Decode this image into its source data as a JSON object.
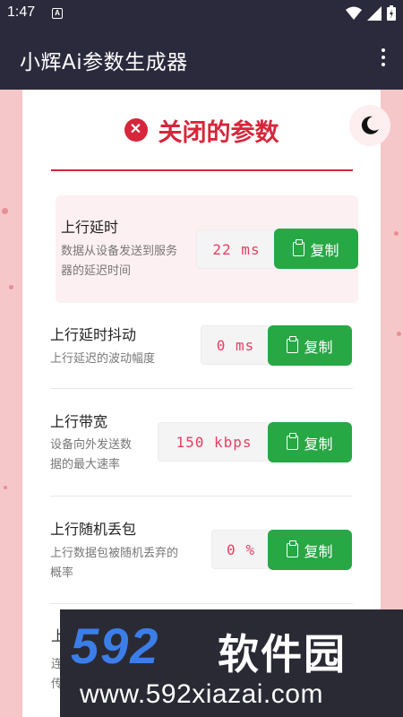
{
  "status_bar": {
    "time": "1:47",
    "notif_badge": "A"
  },
  "app_bar": {
    "title": "小辉Ai参数生成器"
  },
  "header": {
    "title": "关闭的参数"
  },
  "rows": [
    {
      "title": "上行延时",
      "desc_lines": [
        "数据从设备发送到服务",
        "器的延迟时间"
      ],
      "value": "22 ms",
      "copy_label": "复制"
    },
    {
      "title": "上行延时抖动",
      "desc_lines": [
        "上行延迟的波动幅度"
      ],
      "value": "0 ms",
      "copy_label": "复制"
    },
    {
      "title": "上行带宽",
      "desc_lines": [
        "设备向外发送数",
        "据的最大速率"
      ],
      "value": "150 kbps",
      "copy_label": "复制"
    },
    {
      "title": "上行随机丢包",
      "desc_lines": [
        "上行数据包被随机丢弃的",
        "概率"
      ],
      "value": "0 %",
      "copy_label": "复制"
    }
  ],
  "partial_row": {
    "title_peek": "上",
    "desc_peek_1": "连",
    "desc_peek_2": "传"
  },
  "watermark": {
    "brand_num": "592",
    "brand_cn": "软件园",
    "url": "www.592xiazai.com"
  },
  "colors": {
    "appbar": "#2b2a3d",
    "accent_red": "#d6263b",
    "copy_green": "#28a745",
    "value_pink": "#e83e5f"
  }
}
